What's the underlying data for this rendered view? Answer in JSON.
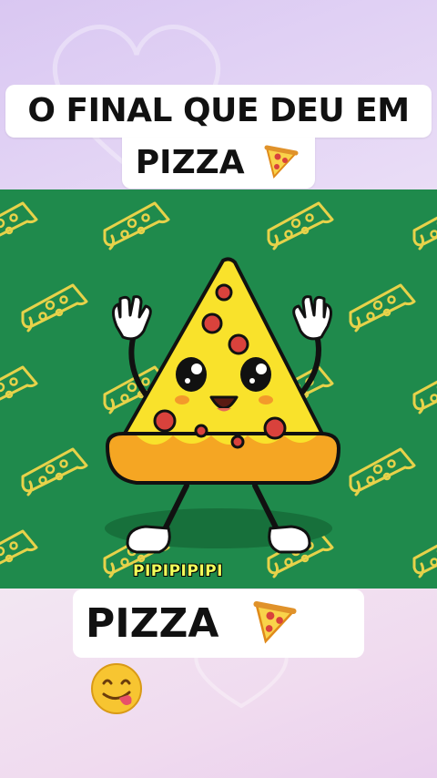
{
  "title": {
    "line1": "O FINAL QUE DEU EM",
    "line2": "PIZZA"
  },
  "caption": "PIPIPIPIPI",
  "bottom_label": "PIZZA",
  "icons": [
    "pizza-slice-icon",
    "yum-face-icon"
  ],
  "colors": {
    "background_top": "#d9c7f2",
    "video_green": "#1f8a4c",
    "pattern_yellow": "#e7d24a",
    "pizza_crust": "#f5a623",
    "pizza_cheese": "#f9e22b",
    "pepperoni": "#d9423c",
    "caption_yellow": "#f2ff5a"
  }
}
